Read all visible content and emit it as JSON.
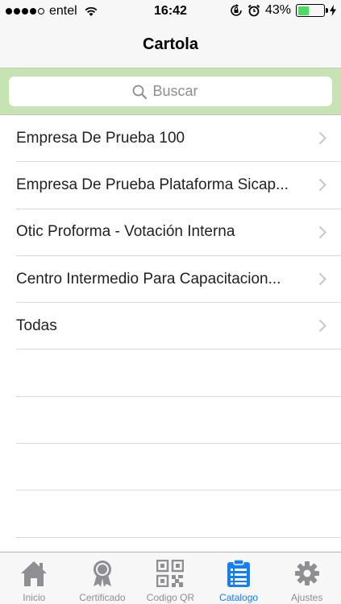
{
  "status_bar": {
    "carrier": "entel",
    "time": "16:42",
    "battery_percent": "43%",
    "battery_level": 0.43,
    "signal_bars_filled": 4,
    "signal_bars_total": 5
  },
  "nav": {
    "title": "Cartola"
  },
  "search": {
    "placeholder": "Buscar"
  },
  "list": {
    "items": [
      {
        "label": "Empresa De Prueba 100"
      },
      {
        "label": "Empresa De Prueba Plataforma Sicap..."
      },
      {
        "label": "Otic Proforma - Votación Interna"
      },
      {
        "label": "Centro Intermedio Para Capacitacion..."
      },
      {
        "label": "Todas"
      }
    ]
  },
  "tabbar": {
    "tabs": [
      {
        "label": "Inicio",
        "icon": "home-icon"
      },
      {
        "label": "Certificado",
        "icon": "award-ribbon-icon"
      },
      {
        "label": "Codigo QR",
        "icon": "qr-code-icon"
      },
      {
        "label": "Catalogo",
        "icon": "clipboard-list-icon",
        "active": true
      },
      {
        "label": "Ajustes",
        "icon": "gear-icon"
      }
    ]
  },
  "colors": {
    "accent": "#147efb",
    "search_bar_bg": "#c8e3b3",
    "tab_inactive": "#8e8e93",
    "battery_green": "#4cd964"
  }
}
